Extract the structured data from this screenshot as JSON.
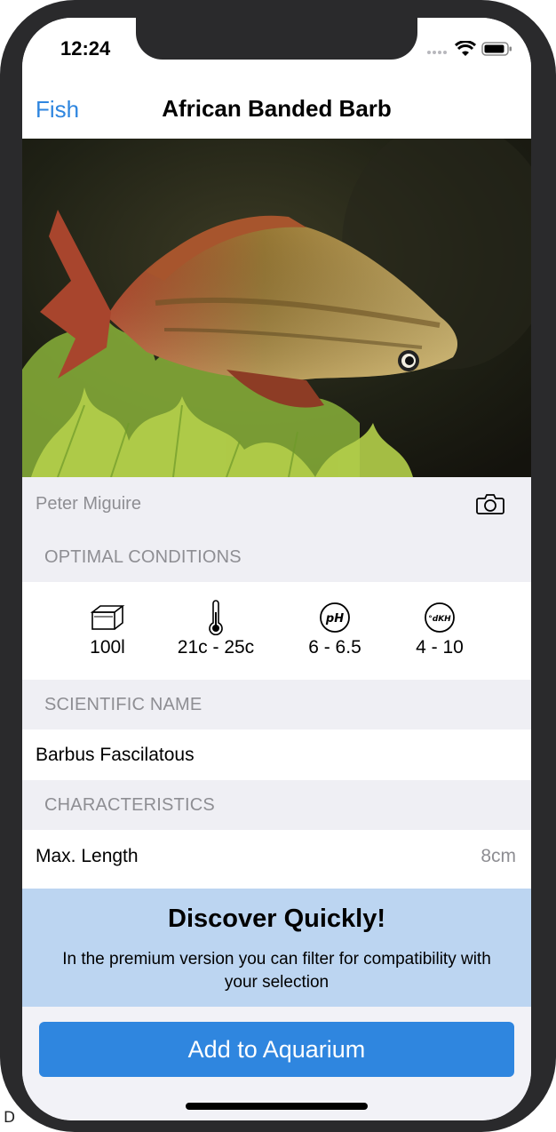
{
  "status": {
    "time": "12:24"
  },
  "nav": {
    "back_label": "Fish",
    "title": "African Banded Barb"
  },
  "hero": {
    "alt": "Photo of fish"
  },
  "photo_credit": "Peter Miguire",
  "sections": {
    "optimal_conditions": "OPTIMAL CONDITIONS",
    "scientific_name": "SCIENTIFIC NAME",
    "characteristics": "CHARACTERISTICS"
  },
  "conditions": {
    "tank": "100l",
    "temperature": "21c - 25c",
    "ph": "6 - 6.5",
    "ph_icon_label": "pH",
    "dkh": "4 - 10",
    "dkh_icon_label": "°dKH"
  },
  "scientific_name": "Barbus Fascilatous",
  "characteristics": {
    "max_length_label": "Max. Length",
    "max_length_value": "8cm"
  },
  "promo": {
    "title": "Discover Quickly!",
    "text": "In the premium version you can filter for compatibility with your selection"
  },
  "add_button": "Add to Aquarium",
  "corner_text": "D",
  "colors": {
    "accent": "#2f86df",
    "promo_bg": "#bcd5f1",
    "section_bg": "#efeff4"
  }
}
